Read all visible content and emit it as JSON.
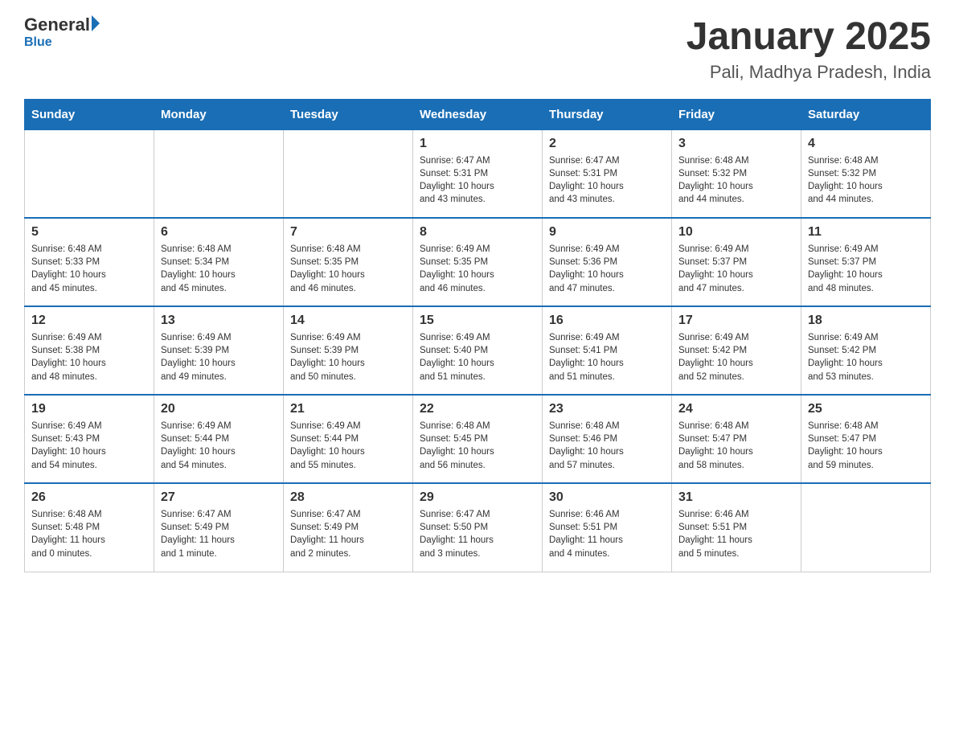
{
  "header": {
    "logo_general": "General",
    "logo_blue": "Blue",
    "title": "January 2025",
    "subtitle": "Pali, Madhya Pradesh, India"
  },
  "days_of_week": [
    "Sunday",
    "Monday",
    "Tuesday",
    "Wednesday",
    "Thursday",
    "Friday",
    "Saturday"
  ],
  "weeks": [
    [
      {
        "day": "",
        "info": ""
      },
      {
        "day": "",
        "info": ""
      },
      {
        "day": "",
        "info": ""
      },
      {
        "day": "1",
        "info": "Sunrise: 6:47 AM\nSunset: 5:31 PM\nDaylight: 10 hours\nand 43 minutes."
      },
      {
        "day": "2",
        "info": "Sunrise: 6:47 AM\nSunset: 5:31 PM\nDaylight: 10 hours\nand 43 minutes."
      },
      {
        "day": "3",
        "info": "Sunrise: 6:48 AM\nSunset: 5:32 PM\nDaylight: 10 hours\nand 44 minutes."
      },
      {
        "day": "4",
        "info": "Sunrise: 6:48 AM\nSunset: 5:32 PM\nDaylight: 10 hours\nand 44 minutes."
      }
    ],
    [
      {
        "day": "5",
        "info": "Sunrise: 6:48 AM\nSunset: 5:33 PM\nDaylight: 10 hours\nand 45 minutes."
      },
      {
        "day": "6",
        "info": "Sunrise: 6:48 AM\nSunset: 5:34 PM\nDaylight: 10 hours\nand 45 minutes."
      },
      {
        "day": "7",
        "info": "Sunrise: 6:48 AM\nSunset: 5:35 PM\nDaylight: 10 hours\nand 46 minutes."
      },
      {
        "day": "8",
        "info": "Sunrise: 6:49 AM\nSunset: 5:35 PM\nDaylight: 10 hours\nand 46 minutes."
      },
      {
        "day": "9",
        "info": "Sunrise: 6:49 AM\nSunset: 5:36 PM\nDaylight: 10 hours\nand 47 minutes."
      },
      {
        "day": "10",
        "info": "Sunrise: 6:49 AM\nSunset: 5:37 PM\nDaylight: 10 hours\nand 47 minutes."
      },
      {
        "day": "11",
        "info": "Sunrise: 6:49 AM\nSunset: 5:37 PM\nDaylight: 10 hours\nand 48 minutes."
      }
    ],
    [
      {
        "day": "12",
        "info": "Sunrise: 6:49 AM\nSunset: 5:38 PM\nDaylight: 10 hours\nand 48 minutes."
      },
      {
        "day": "13",
        "info": "Sunrise: 6:49 AM\nSunset: 5:39 PM\nDaylight: 10 hours\nand 49 minutes."
      },
      {
        "day": "14",
        "info": "Sunrise: 6:49 AM\nSunset: 5:39 PM\nDaylight: 10 hours\nand 50 minutes."
      },
      {
        "day": "15",
        "info": "Sunrise: 6:49 AM\nSunset: 5:40 PM\nDaylight: 10 hours\nand 51 minutes."
      },
      {
        "day": "16",
        "info": "Sunrise: 6:49 AM\nSunset: 5:41 PM\nDaylight: 10 hours\nand 51 minutes."
      },
      {
        "day": "17",
        "info": "Sunrise: 6:49 AM\nSunset: 5:42 PM\nDaylight: 10 hours\nand 52 minutes."
      },
      {
        "day": "18",
        "info": "Sunrise: 6:49 AM\nSunset: 5:42 PM\nDaylight: 10 hours\nand 53 minutes."
      }
    ],
    [
      {
        "day": "19",
        "info": "Sunrise: 6:49 AM\nSunset: 5:43 PM\nDaylight: 10 hours\nand 54 minutes."
      },
      {
        "day": "20",
        "info": "Sunrise: 6:49 AM\nSunset: 5:44 PM\nDaylight: 10 hours\nand 54 minutes."
      },
      {
        "day": "21",
        "info": "Sunrise: 6:49 AM\nSunset: 5:44 PM\nDaylight: 10 hours\nand 55 minutes."
      },
      {
        "day": "22",
        "info": "Sunrise: 6:48 AM\nSunset: 5:45 PM\nDaylight: 10 hours\nand 56 minutes."
      },
      {
        "day": "23",
        "info": "Sunrise: 6:48 AM\nSunset: 5:46 PM\nDaylight: 10 hours\nand 57 minutes."
      },
      {
        "day": "24",
        "info": "Sunrise: 6:48 AM\nSunset: 5:47 PM\nDaylight: 10 hours\nand 58 minutes."
      },
      {
        "day": "25",
        "info": "Sunrise: 6:48 AM\nSunset: 5:47 PM\nDaylight: 10 hours\nand 59 minutes."
      }
    ],
    [
      {
        "day": "26",
        "info": "Sunrise: 6:48 AM\nSunset: 5:48 PM\nDaylight: 11 hours\nand 0 minutes."
      },
      {
        "day": "27",
        "info": "Sunrise: 6:47 AM\nSunset: 5:49 PM\nDaylight: 11 hours\nand 1 minute."
      },
      {
        "day": "28",
        "info": "Sunrise: 6:47 AM\nSunset: 5:49 PM\nDaylight: 11 hours\nand 2 minutes."
      },
      {
        "day": "29",
        "info": "Sunrise: 6:47 AM\nSunset: 5:50 PM\nDaylight: 11 hours\nand 3 minutes."
      },
      {
        "day": "30",
        "info": "Sunrise: 6:46 AM\nSunset: 5:51 PM\nDaylight: 11 hours\nand 4 minutes."
      },
      {
        "day": "31",
        "info": "Sunrise: 6:46 AM\nSunset: 5:51 PM\nDaylight: 11 hours\nand 5 minutes."
      },
      {
        "day": "",
        "info": ""
      }
    ]
  ]
}
